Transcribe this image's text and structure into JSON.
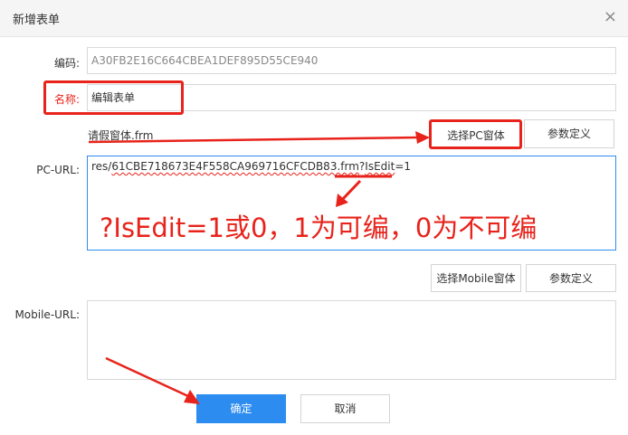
{
  "dialog": {
    "title": "新增表单",
    "close_glyph": "×"
  },
  "form": {
    "code_label": "编码:",
    "code_value": "A30FB2E16C664CBEA1DEF895D55CE940",
    "name_label": "名称:",
    "name_value": "编辑表单",
    "pc_form_name": "请假窗体.frm",
    "select_pc_button": "选择PC窗体",
    "pc_param_button": "参数定义",
    "pc_url_label": "PC-URL:",
    "pc_url_prefix": "res/",
    "pc_url_file": "61CBE718673E4F558CA969716CFCDB83.frm",
    "pc_url_q": "?",
    "pc_url_param": "IsEdit",
    "pc_url_suffix": "=1",
    "select_mobile_button": "选择Mobile窗体",
    "mobile_param_button": "参数定义",
    "mobile_url_label": "Mobile-URL:",
    "mobile_url_value": ""
  },
  "annotation": {
    "text": "?IsEdit=1或0，1为可编，0为不可编",
    "color": "#e8231b"
  },
  "footer": {
    "confirm_button": "确定",
    "cancel_button": "取消"
  },
  "colors": {
    "primary": "#2d8cf0",
    "highlight": "#e8231b"
  }
}
